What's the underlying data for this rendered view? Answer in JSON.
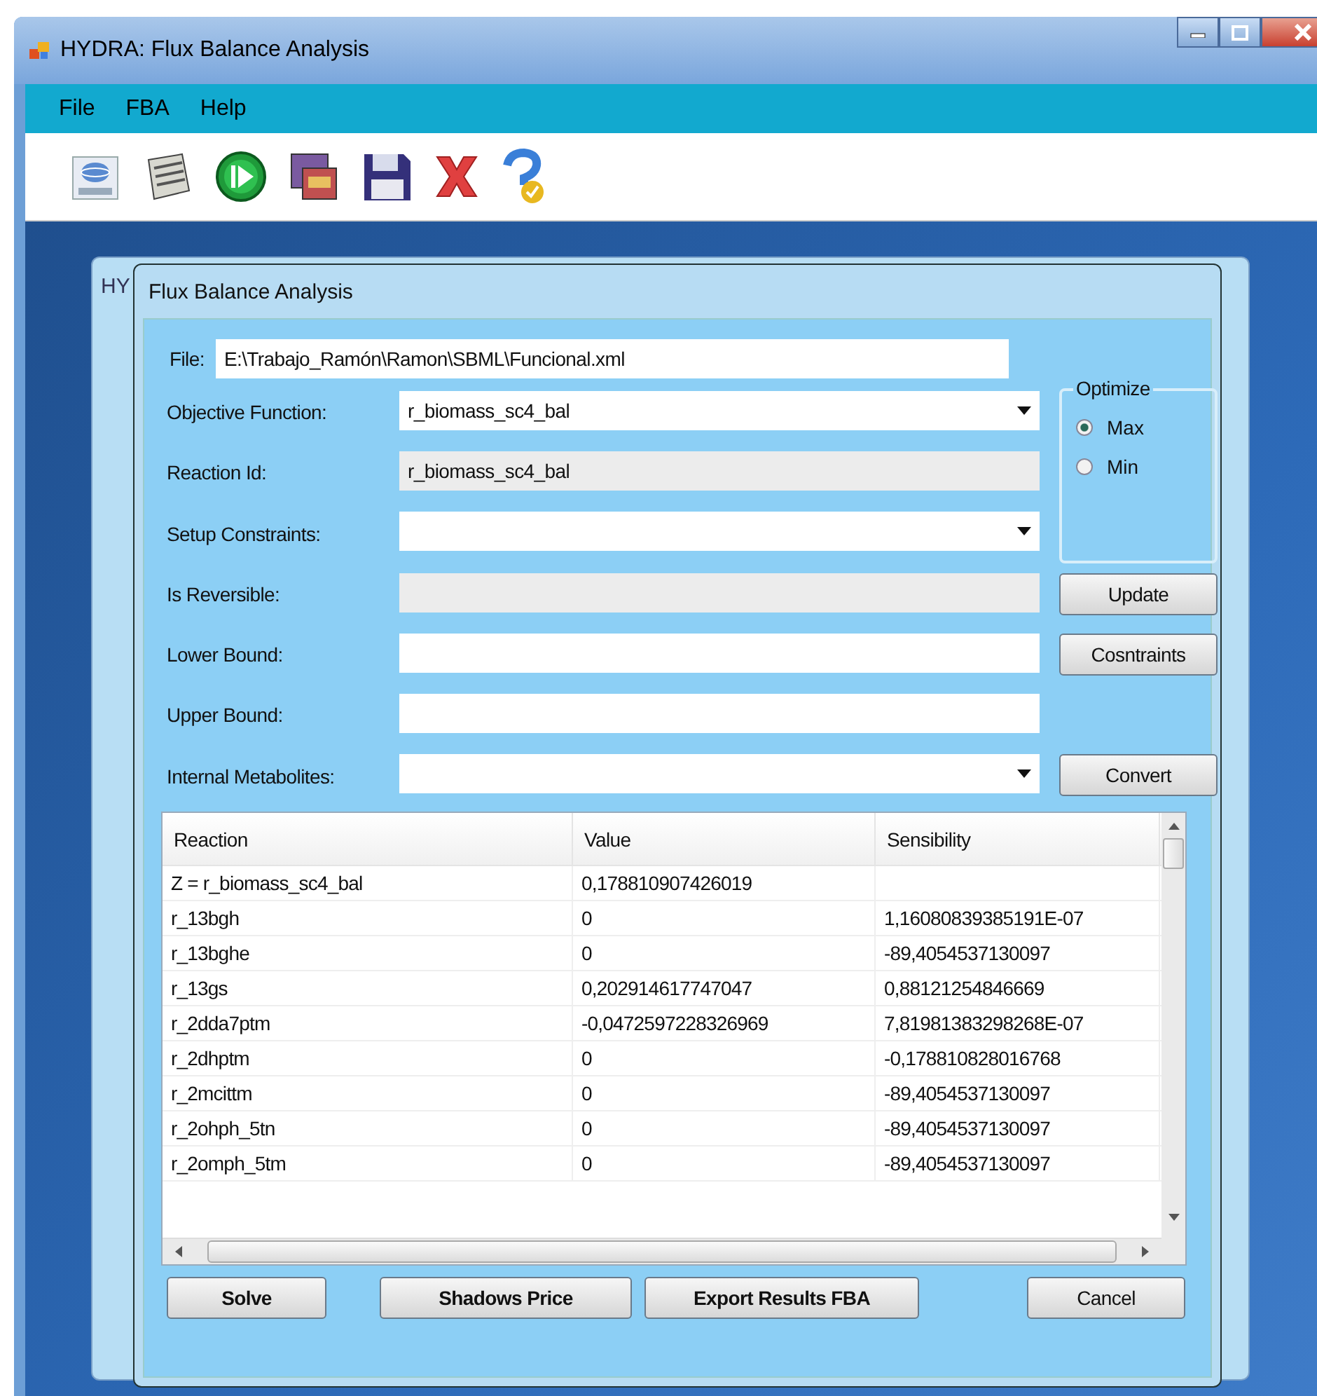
{
  "window": {
    "title": "HYDRA: Flux Balance Analysis"
  },
  "menu": [
    "File",
    "FBA",
    "Help"
  ],
  "background_window": {
    "title": "HY"
  },
  "dialog": {
    "title": "Flux Balance Analysis",
    "file": {
      "label": "File:",
      "value": "E:\\Trabajo_Ramón\\Ramon\\SBML\\Funcional.xml"
    },
    "fields": [
      {
        "kind": "combo",
        "label": "Objective Function:",
        "value": "r_biomass_sc4_bal"
      },
      {
        "kind": "readonly",
        "label": "Reaction Id:",
        "value": "r_biomass_sc4_bal"
      },
      {
        "kind": "combo",
        "label": "Setup Constraints:"
      },
      {
        "kind": "disabled",
        "label": "Is Reversible:",
        "button": "Update"
      },
      {
        "kind": "text",
        "label": "Lower Bound:",
        "button": "Cosntraints"
      },
      {
        "kind": "text",
        "label": "Upper Bound:"
      },
      {
        "kind": "combo",
        "label": "Internal Metabolites:",
        "button": "Convert"
      }
    ],
    "optimize": {
      "title": "Optimize",
      "options": [
        {
          "label": "Max",
          "selected": true
        },
        {
          "label": "Min",
          "selected": false
        }
      ]
    },
    "table": {
      "columns": [
        "Reaction",
        "Value",
        "Sensibility"
      ],
      "rows": [
        [
          "Z = r_biomass_sc4_bal",
          "0,178810907426019"
        ],
        [
          "r_13bgh",
          "0",
          "1,16080839385191E-07"
        ],
        [
          "r_13bghe",
          "0",
          "-89,4054537130097"
        ],
        [
          "r_13gs",
          "0,202914617747047",
          "0,88121254846669"
        ],
        [
          "r_2dda7ptm",
          "-0,0472597228326969",
          "7,81981383298268E-07"
        ],
        [
          "r_2dhptm",
          "0",
          "-0,178810828016768"
        ],
        [
          "r_2mcittm",
          "0",
          "-89,4054537130097"
        ],
        [
          "r_2ohph_5tn",
          "0",
          "-89,4054537130097"
        ],
        [
          "r_2omph_5tm",
          "0",
          "-89,4054537130097"
        ]
      ]
    },
    "buttons": [
      {
        "label": "Solve",
        "bold": true
      },
      {
        "label": "Shadows Price",
        "bold": true
      },
      {
        "label": "Export Results FBA",
        "bold": true
      },
      {
        "label": "Cancel",
        "bold": false
      }
    ]
  }
}
